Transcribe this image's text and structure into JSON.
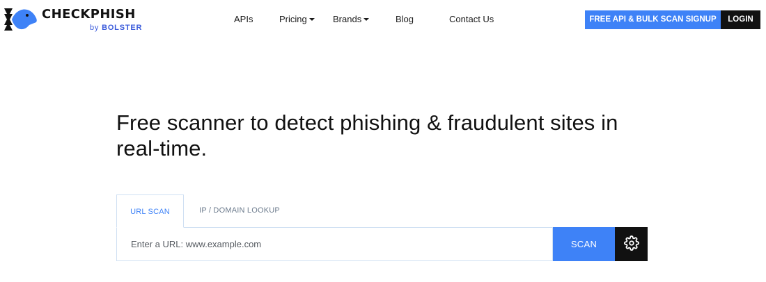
{
  "brand": {
    "name": "CHECKPHISH",
    "sub_prefix": "by ",
    "sub_name": "BOLSTER",
    "accent_color": "#3e82f7",
    "logo_icon": "fish-logo-icon"
  },
  "nav": {
    "items": [
      {
        "label": "APIs",
        "has_dropdown": false
      },
      {
        "label": "Pricing",
        "has_dropdown": true
      },
      {
        "label": "Brands",
        "has_dropdown": true
      },
      {
        "label": "Blog",
        "has_dropdown": false
      },
      {
        "label": "Contact Us",
        "has_dropdown": false
      }
    ],
    "signup_label": "FREE API & BULK SCAN SIGNUP",
    "login_label": "LOGIN"
  },
  "hero": {
    "title": "Free scanner to detect phishing & fraudulent sites in real-time."
  },
  "scan": {
    "tabs": [
      {
        "label": "URL SCAN",
        "active": true
      },
      {
        "label": "IP / DOMAIN LOOKUP",
        "active": false
      }
    ],
    "input_placeholder": "Enter a URL: www.example.com",
    "input_value": "",
    "scan_label": "SCAN",
    "settings_icon": "gear-icon"
  }
}
